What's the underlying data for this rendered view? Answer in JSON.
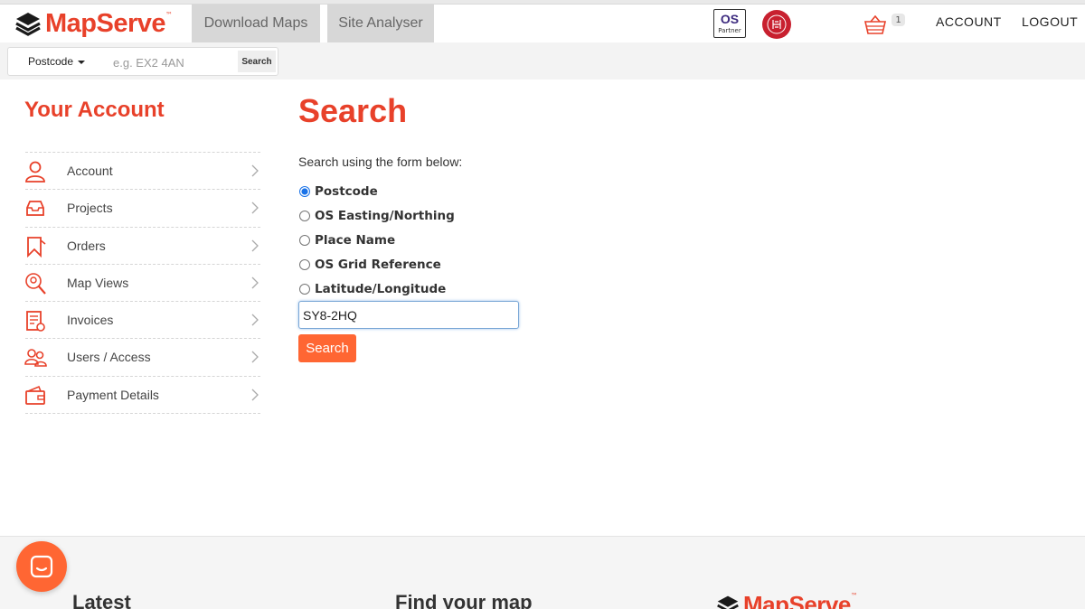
{
  "header": {
    "logo_text": "MapServe",
    "logo_tm": "™",
    "tabs": [
      {
        "label": "Download Maps"
      },
      {
        "label": "Site Analyser"
      }
    ],
    "os_badge": {
      "mark": "OS",
      "caption": "Partner"
    },
    "cart_count": "1",
    "account_label": "ACCOUNT",
    "logout_label": "LOGOUT"
  },
  "quick_search": {
    "type_label": "Postcode",
    "placeholder": "e.g. EX2 4AN",
    "button_label": "Search"
  },
  "sidebar": {
    "title": "Your Account",
    "items": [
      {
        "label": "Account",
        "icon": "user-icon"
      },
      {
        "label": "Projects",
        "icon": "inbox-tray-icon"
      },
      {
        "label": "Orders",
        "icon": "bookmark-icon"
      },
      {
        "label": "Map Views",
        "icon": "map-pin-search-icon"
      },
      {
        "label": "Invoices",
        "icon": "invoice-icon"
      },
      {
        "label": "Users / Access",
        "icon": "users-icon"
      },
      {
        "label": "Payment Details",
        "icon": "wallet-icon"
      }
    ]
  },
  "main": {
    "title": "Search",
    "intro": "Search using the form below:",
    "options": [
      {
        "label": "Postcode",
        "selected": true
      },
      {
        "label": "OS Easting/Northing",
        "selected": false
      },
      {
        "label": "Place Name",
        "selected": false
      },
      {
        "label": "OS Grid Reference",
        "selected": false
      },
      {
        "label": "Latitude/Longitude",
        "selected": false
      }
    ],
    "input_value": "SY8-2HQ",
    "button_label": "Search"
  },
  "footer": {
    "headings": [
      "Latest",
      "Find your map"
    ],
    "logo_text": "MapServe",
    "logo_tm": "™"
  },
  "colors": {
    "brand": "#e8412a",
    "button": "#ff6633",
    "os_purple": "#3d2b7f",
    "seal_red": "#c8202f"
  }
}
